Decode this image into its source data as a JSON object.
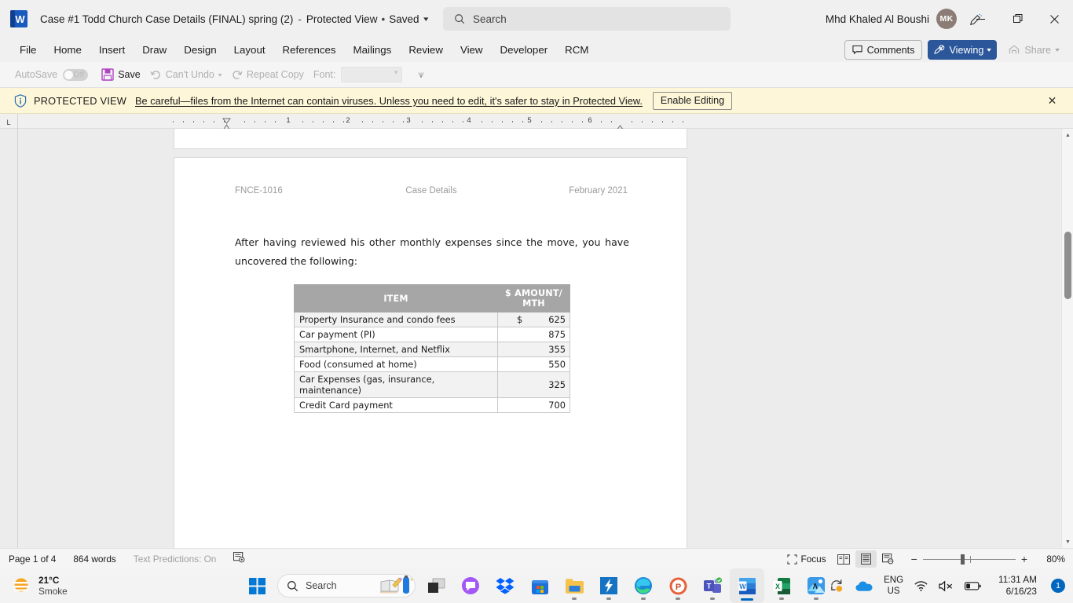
{
  "titlebar": {
    "app_icon": "word-logo",
    "doc_title": "Case #1 Todd Church Case Details (FINAL) spring (2)",
    "separator": "-",
    "protected_label": "Protected View",
    "bullet": "•",
    "saved_label": "Saved",
    "search_placeholder": "Search",
    "user_name": "Mhd Khaled Al Boushi",
    "user_initials": "MK",
    "minimize": "–",
    "restore": "❐",
    "close": "✕"
  },
  "ribbon": {
    "tabs": [
      {
        "label": "File"
      },
      {
        "label": "Home"
      },
      {
        "label": "Insert"
      },
      {
        "label": "Draw"
      },
      {
        "label": "Design"
      },
      {
        "label": "Layout"
      },
      {
        "label": "References"
      },
      {
        "label": "Mailings"
      },
      {
        "label": "Review"
      },
      {
        "label": "View"
      },
      {
        "label": "Developer"
      },
      {
        "label": "RCM"
      }
    ],
    "comments_label": "Comments",
    "viewing_label": "Viewing",
    "viewing_caret": "▾",
    "share_label": "Share",
    "share_caret": "▾",
    "accent_color": "#2b579a"
  },
  "quickbar": {
    "autosave_label": "AutoSave",
    "autosave_state": "Off",
    "save_label": "Save",
    "undo_label": "Can't Undo",
    "undo_caret": "▾",
    "repeat_label": "Repeat Copy",
    "font_label": "Font:",
    "font_value": "",
    "more_label": "⩛"
  },
  "protected_view": {
    "title": "PROTECTED VIEW",
    "message": "Be careful—files from the Internet can contain viruses. Unless you need to edit, it's safer to stay in Protected View.",
    "button_label": "Enable Editing",
    "close_label": "✕",
    "background_color": "#fdf6d8"
  },
  "ruler": {
    "corner_label": "L",
    "numbers": [
      "1",
      "2",
      "3",
      "4",
      "5",
      "6"
    ]
  },
  "document": {
    "header": {
      "left": "FNCE-1016",
      "center": "Case Details",
      "right": "February 2021"
    },
    "paragraph": "After having reviewed his other monthly expenses since the move, you have uncovered the following:",
    "table": {
      "headers": [
        "ITEM",
        "$ AMOUNT/ MTH"
      ],
      "header_line1": "ITEM",
      "header2_line1": "$ AMOUNT/",
      "header2_line2": "MTH",
      "currency_symbol": "$",
      "rows": [
        {
          "item": "Property Insurance and condo fees",
          "amount": "625",
          "currency": "$"
        },
        {
          "item": "Car payment (PI)",
          "amount": "875",
          "currency": ""
        },
        {
          "item": "Smartphone, Internet, and Netflix",
          "amount": "355",
          "currency": ""
        },
        {
          "item": "Food (consumed at home)",
          "amount": "550",
          "currency": ""
        },
        {
          "item": "Car Expenses (gas, insurance, maintenance)",
          "amount": "325",
          "currency": ""
        },
        {
          "item": "Credit Card payment",
          "amount": "700",
          "currency": ""
        }
      ],
      "header_bg": "#a6a6a6"
    }
  },
  "scrollbar": {
    "up_arrow": "▲",
    "down_arrow": "▼"
  },
  "statusbar": {
    "page_label": "Page 1 of 4",
    "word_count": "864 words",
    "text_predictions": "Text Predictions: On",
    "focus_label": "Focus",
    "zoom_out": "−",
    "zoom_in": "+",
    "zoom_value": "80%"
  },
  "taskbar": {
    "weather_temp": "21°C",
    "weather_condition": "Smoke",
    "search_placeholder": "Search",
    "apps": [
      {
        "name": "start-button"
      },
      {
        "name": "taskbar-search"
      },
      {
        "name": "widgets-icon"
      },
      {
        "name": "task-view-icon"
      },
      {
        "name": "skype-icon"
      },
      {
        "name": "dropbox-icon"
      },
      {
        "name": "microsoft-store-icon"
      },
      {
        "name": "file-explorer-icon"
      },
      {
        "name": "shortcut-app-icon"
      },
      {
        "name": "edge-icon"
      },
      {
        "name": "powerpoint-icon"
      },
      {
        "name": "teams-icon"
      },
      {
        "name": "word-icon"
      },
      {
        "name": "excel-icon"
      },
      {
        "name": "photos-icon"
      }
    ],
    "tray": {
      "chevron": "∧",
      "language_line1": "ENG",
      "language_line2": "US",
      "time": "11:31 AM",
      "date": "6/16/23",
      "notification_count": "1"
    }
  }
}
